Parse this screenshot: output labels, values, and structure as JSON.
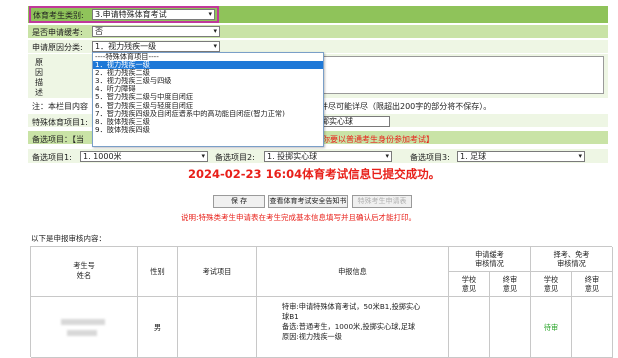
{
  "form": {
    "category_label": "体育考生类别:",
    "category_value": "3.申请特殊体育考试",
    "retake_label": "是否申请缓考:",
    "retake_value": "否",
    "reason_type_label": "申请原因分类:",
    "reason_type_value": "1．视力残疾一级",
    "reason_detail_label": [
      "原",
      "因",
      "描",
      "述"
    ],
    "note_prefix": "注：本栏目内容",
    "note_suffix": "并尽可能详尽（限超出200字的部分将不保存）。",
    "special_item_label": "特殊体育项目1:",
    "special_item_value": "投掷实心球",
    "alt_header_prefix": "备选项目：【当",
    "alt_header_suffix": "你要以普通考生身份参加考试】",
    "alt1_label": "备选项目1:",
    "alt1_value": "1. 1000米",
    "alt2_label": "备选项目2:",
    "alt2_value": "1. 投掷实心球",
    "alt3_label": "备选项目3:",
    "alt3_value": "1. 足球"
  },
  "dropdown": {
    "options": [
      "----特殊体育项目----",
      "1．视力残疾一级",
      "2．视力残疾二级",
      "3．视力残疾三级与四级",
      "4．听力障碍",
      "5．智力残疾二级与中度自闭症",
      "6．智力残疾三级与轻度自闭症",
      "7．智力残疾四级及自闭症谱系中的高功能自闭症(智力正常)",
      "8．肢体残疾三级",
      "9．肢体残疾四级"
    ],
    "highlighted_index": 1
  },
  "status": {
    "submitted_message": "2024-02-23 16:04体育考试信息已提交成功。",
    "instruction": "说明:特殊类考生申请表在考生完成基本信息填写并且确认后才能打印。"
  },
  "buttons": {
    "save": "保 存",
    "view_notice": "查看体育考试安全告知书",
    "print_form": "特殊考生申请表"
  },
  "review": {
    "section_title": "以下是申报审核内容：",
    "headers": {
      "student": "考生号\n姓名",
      "gender": "性别",
      "exam_item": "考试项目",
      "declaration": "申报信息",
      "deferral_review": "申请缓考\n审核情况",
      "exempt_review": "择考、免考\n审核情况",
      "school_opinion": "学校\n意见",
      "final_opinion": "终审\n意见"
    },
    "row": {
      "gender": "男",
      "declaration_lines": [
        "特审:申请特殊体育考试，50米B1,投掷实心",
        "球B1",
        "备选:普通考生，1000米,投掷实心球,足球",
        "原因:视力残疾一级"
      ],
      "exempt_school_opinion": "待审"
    }
  },
  "colors": {
    "header_green": "#8fc35a",
    "light_green": "#c9e3a6",
    "highlight_border": "#c0399a",
    "alert_red": "#e8201a",
    "pending_green": "#2aa52a",
    "select_highlight": "#1e78d7"
  }
}
